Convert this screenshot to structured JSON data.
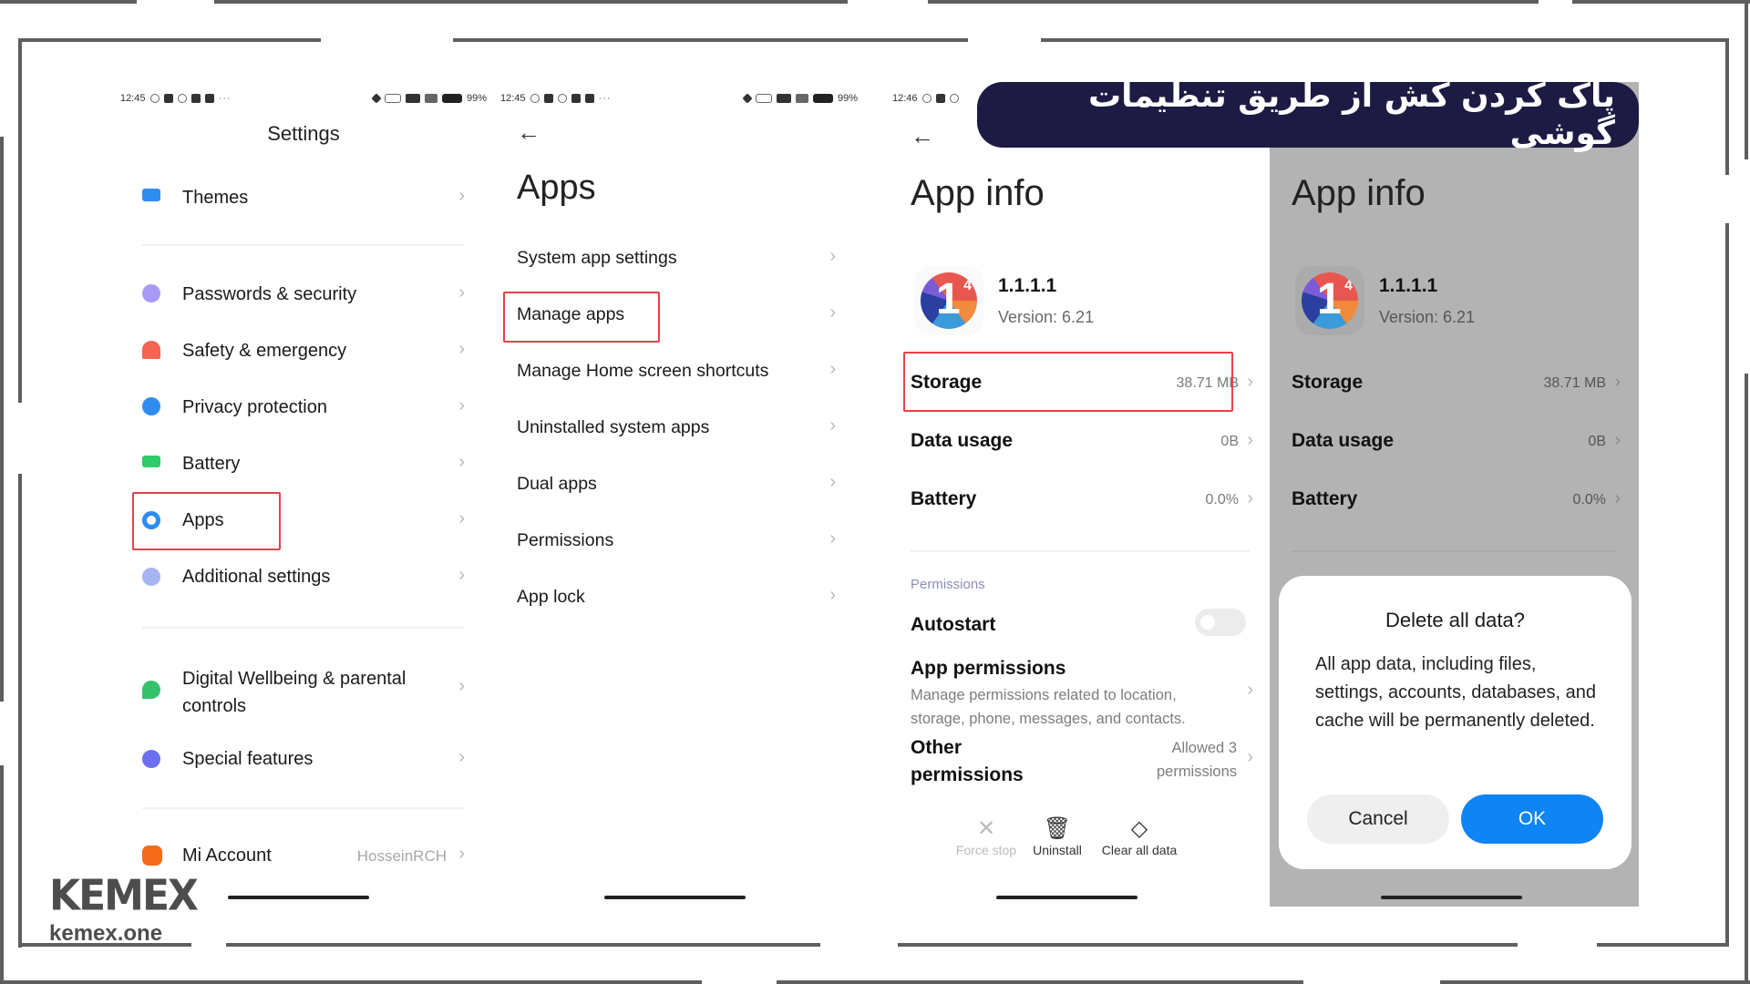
{
  "banner": {
    "title": "پاک کردن کش از طریق تنظیمات گوشی"
  },
  "brand": {
    "logo": "KEMEX",
    "url": "kemex.one",
    "accent": "#1d1b43",
    "highlight": "#e8414a",
    "primary_button": "#0e84f5"
  },
  "settings_screen": {
    "status": {
      "time": "12:45",
      "battery": "99%"
    },
    "title": "Settings",
    "items": [
      {
        "label": "Themes",
        "icon": "themes-icon"
      },
      {
        "label": "Passwords & security",
        "icon": "fingerprint-icon"
      },
      {
        "label": "Safety & emergency",
        "icon": "siren-icon"
      },
      {
        "label": "Privacy protection",
        "icon": "privacy-icon"
      },
      {
        "label": "Battery",
        "icon": "battery-icon"
      },
      {
        "label": "Apps",
        "icon": "gear-icon",
        "highlighted": true
      },
      {
        "label": "Additional settings",
        "icon": "more-icon"
      },
      {
        "label": "Digital Wellbeing & parental",
        "label2": "controls",
        "icon": "wellbeing-icon"
      },
      {
        "label": "Special features",
        "icon": "flask-icon"
      },
      {
        "label": "Mi Account",
        "value": "HosseinRCH",
        "icon": "mi-icon"
      }
    ]
  },
  "apps_screen": {
    "status": {
      "time": "12:45",
      "battery": "99%"
    },
    "back": "←",
    "title": "Apps",
    "items": [
      {
        "label": "System app settings"
      },
      {
        "label": "Manage apps",
        "highlighted": true
      },
      {
        "label": "Manage Home screen shortcuts"
      },
      {
        "label": "Uninstalled system apps"
      },
      {
        "label": "Dual apps"
      },
      {
        "label": "Permissions"
      },
      {
        "label": "App lock"
      }
    ]
  },
  "app_info_screen": {
    "status": {
      "time": "12:46"
    },
    "back": "←",
    "title": "App info",
    "app": {
      "name": "1.1.1.1",
      "version": "Version: 6.21"
    },
    "rows": [
      {
        "label": "Storage",
        "value": "38.71 MB",
        "highlighted": true
      },
      {
        "label": "Data usage",
        "value": "0B"
      },
      {
        "label": "Battery",
        "value": "0.0%"
      }
    ],
    "section": "Permissions",
    "autostart": {
      "label": "Autostart",
      "enabled": false
    },
    "app_permissions": {
      "label": "App permissions",
      "desc1": "Manage permissions related to location,",
      "desc2": "storage, phone, messages, and contacts."
    },
    "other_permissions": {
      "label1": "Other",
      "label2": "permissions",
      "value1": "Allowed 3",
      "value2": "permissions"
    },
    "actions": [
      {
        "label": "Force stop",
        "icon": "close-icon",
        "enabled": false
      },
      {
        "label": "Uninstall",
        "icon": "trash-icon",
        "enabled": true
      },
      {
        "label": "Clear all data",
        "icon": "eraser-icon",
        "enabled": true
      }
    ]
  },
  "dialog_screen": {
    "title": "App info",
    "app": {
      "name": "1.1.1.1",
      "version": "Version: 6.21"
    },
    "rows": [
      {
        "label": "Storage",
        "value": "38.71 MB"
      },
      {
        "label": "Data usage",
        "value": "0B"
      },
      {
        "label": "Battery",
        "value": "0.0%"
      }
    ],
    "dialog": {
      "title": "Delete all data?",
      "body": "All app data, including files, settings, accounts, databases, and cache will be permanently deleted.",
      "cancel": "Cancel",
      "ok": "OK"
    }
  },
  "chevron": "›"
}
